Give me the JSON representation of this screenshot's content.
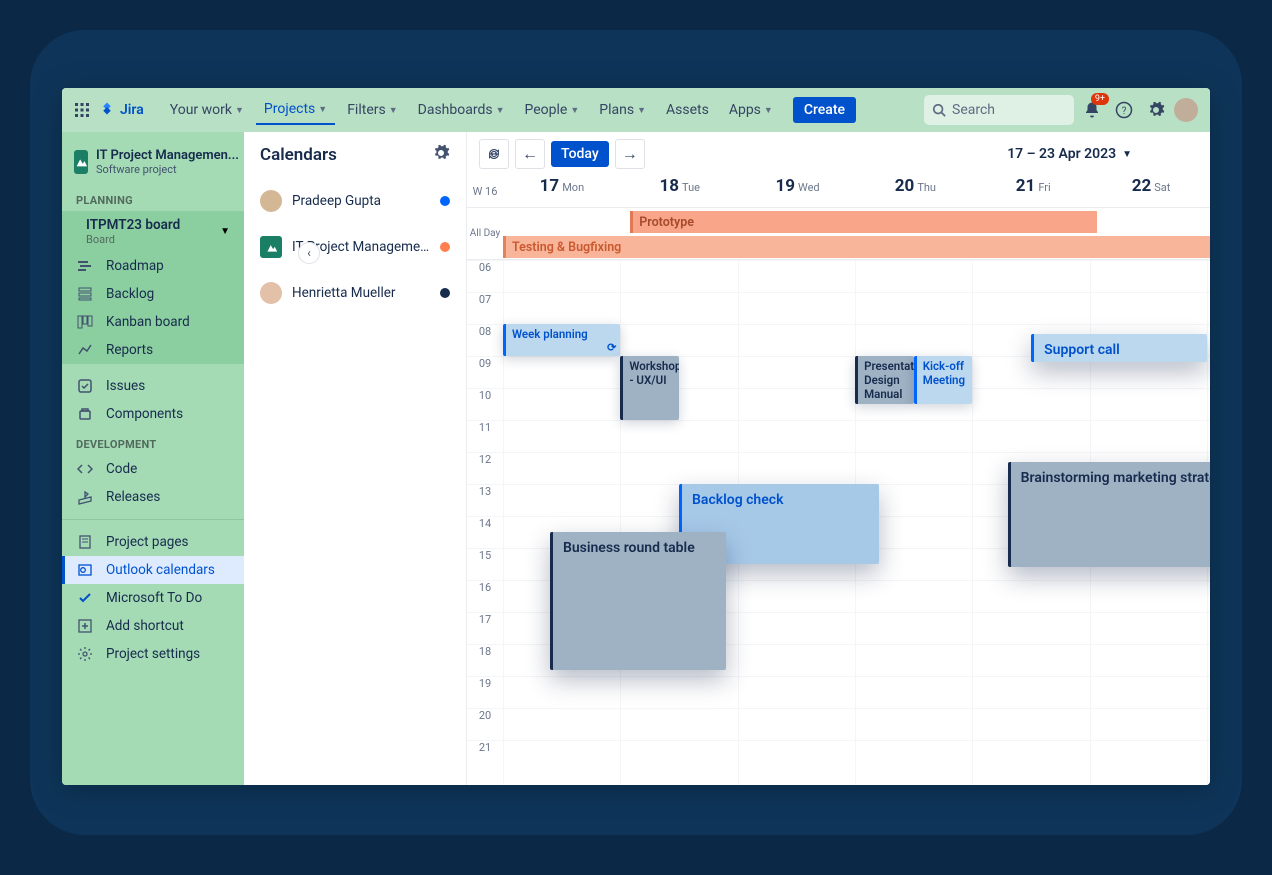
{
  "logo": "Jira",
  "nav": {
    "your_work": "Your work",
    "projects": "Projects",
    "filters": "Filters",
    "dashboards": "Dashboards",
    "people": "People",
    "plans": "Plans",
    "assets": "Assets",
    "apps": "Apps",
    "create": "Create"
  },
  "search_placeholder": "Search",
  "badge_count": "9+",
  "project": {
    "name": "IT Project Managemen...",
    "subtype": "Software project"
  },
  "sections": {
    "planning": "PLANNING",
    "development": "DEVELOPMENT"
  },
  "board": {
    "name": "ITPMT23 board",
    "label": "Board"
  },
  "sidebar": {
    "roadmap": "Roadmap",
    "backlog": "Backlog",
    "kanban": "Kanban board",
    "reports": "Reports",
    "issues": "Issues",
    "components": "Components",
    "code": "Code",
    "releases": "Releases",
    "project_pages": "Project pages",
    "outlook": "Outlook calendars",
    "todo": "Microsoft To Do",
    "add_shortcut": "Add shortcut",
    "project_settings": "Project settings"
  },
  "calendars_title": "Calendars",
  "calendars": [
    {
      "name": "Pradeep Gupta",
      "color": "#0065ff",
      "type": "person"
    },
    {
      "name": "IT Project Management T...",
      "color": "#ff7f50",
      "type": "project"
    },
    {
      "name": "Henrietta Mueller",
      "color": "#172b4d",
      "type": "person"
    }
  ],
  "controls": {
    "today": "Today",
    "range": "17 – 23 Apr 2023"
  },
  "week_label": "W 16",
  "days": [
    {
      "num": "17",
      "name": "Mon"
    },
    {
      "num": "18",
      "name": "Tue"
    },
    {
      "num": "19",
      "name": "Wed"
    },
    {
      "num": "20",
      "name": "Thu"
    },
    {
      "num": "21",
      "name": "Fri"
    },
    {
      "num": "22",
      "name": "Sat"
    }
  ],
  "allday_label": "All Day",
  "allday_events": [
    {
      "title": "Prototype",
      "left_pct": 18,
      "width_pct": 66,
      "bg": "#f9a58a",
      "border": "#de7a56",
      "color": "#a54a2a",
      "row": 0
    },
    {
      "title": "Testing & Bugfixing",
      "left_pct": 0,
      "width_pct": 110,
      "bg": "#f9b59a",
      "border": "#e58058",
      "color": "#c95a30",
      "row": 1
    }
  ],
  "hours": [
    "06",
    "07",
    "08",
    "09",
    "10",
    "11",
    "12",
    "13",
    "14",
    "15",
    "16",
    "17",
    "18",
    "19",
    "20",
    "21"
  ],
  "col_width_pct": 16.6,
  "events": [
    {
      "title": "Week planning",
      "day": 0,
      "top_hr": 2,
      "dur_hr": 1,
      "w_day": 1,
      "bg": "#bcd8ef",
      "border": "#0065ff",
      "color": "#0052cc",
      "refresh": true
    },
    {
      "title": "Workshop - UX/UI",
      "day": 1,
      "top_hr": 3,
      "dur_hr": 2,
      "w_day": 0.5,
      "bg": "#9fb2c4",
      "border": "#172b4d",
      "color": "#172b4d"
    },
    {
      "title": "Presentation Design Manual",
      "day": 3,
      "top_hr": 3,
      "dur_hr": 1.5,
      "w_day": 0.5,
      "bg": "#9fb2c4",
      "border": "#172b4d",
      "color": "#172b4d"
    },
    {
      "title": "Kick-off Meeting",
      "day": 3.5,
      "top_hr": 3,
      "dur_hr": 1.5,
      "w_day": 0.5,
      "bg": "#bcd8ef",
      "border": "#0065ff",
      "color": "#0052cc"
    },
    {
      "title": "Support call",
      "day": 4.5,
      "top_hr": 2.3,
      "dur_hr": 0.9,
      "w_day": 1.5,
      "bg": "#bcd8ef",
      "border": "#0065ff",
      "color": "#0052cc",
      "big": true
    },
    {
      "title": "Backlog check",
      "day": 1.5,
      "top_hr": 7,
      "dur_hr": 2.5,
      "w_day": 1.7,
      "bg": "#a7c9e8",
      "border": "#0065ff",
      "color": "#0052cc",
      "big": true
    },
    {
      "title": "Business round table",
      "day": 0.4,
      "top_hr": 8.5,
      "dur_hr": 4.3,
      "w_day": 1.5,
      "bg": "#9fb2c4",
      "border": "#172b4d",
      "color": "#172b4d",
      "big": true
    },
    {
      "title": "Brainstorming marketing strategy",
      "day": 4.3,
      "top_hr": 6.3,
      "dur_hr": 3.3,
      "w_day": 2.1,
      "bg": "#9fb2c4",
      "border": "#172b4d",
      "color": "#172b4d",
      "big": true
    }
  ]
}
